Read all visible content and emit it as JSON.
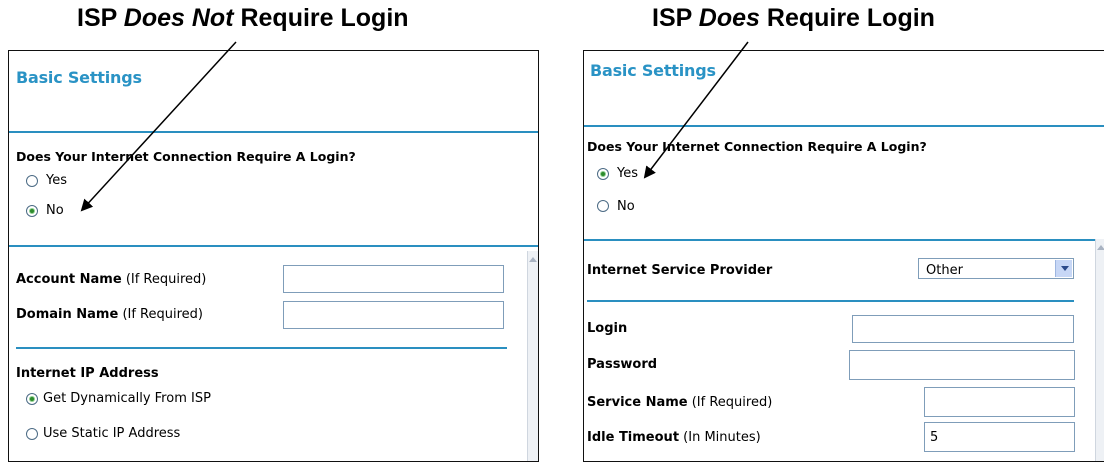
{
  "left": {
    "caption_a": "ISP ",
    "caption_em": "Does Not",
    "caption_b": " Require Login",
    "title": "Basic Settings",
    "question": "Does Your Internet Connection Require A Login?",
    "login_options": [
      {
        "label": "Yes",
        "selected": false
      },
      {
        "label": "No",
        "selected": true
      }
    ],
    "account_name_label": "Account Name",
    "account_name_hint": "(If Required)",
    "account_name_value": "",
    "domain_name_label": "Domain Name",
    "domain_name_hint": "(If Required)",
    "domain_name_value": "",
    "ip_section_label": "Internet IP Address",
    "ip_options": [
      {
        "label": "Get Dynamically From ISP",
        "selected": true
      },
      {
        "label": "Use Static IP Address",
        "selected": false
      }
    ]
  },
  "right": {
    "caption_a": "ISP ",
    "caption_em": "Does",
    "caption_b": " Require Login",
    "title": "Basic Settings",
    "question": "Does Your Internet Connection Require A Login?",
    "login_options": [
      {
        "label": "Yes",
        "selected": true
      },
      {
        "label": "No",
        "selected": false
      }
    ],
    "isp_label": "Internet Service Provider",
    "isp_selected": "Other",
    "login_label": "Login",
    "login_value": "",
    "password_label": "Password",
    "password_value": "",
    "service_name_label": "Service Name",
    "service_name_hint": "(If Required)",
    "service_name_value": "",
    "idle_timeout_label": "Idle Timeout",
    "idle_timeout_hint": "(In Minutes)",
    "idle_timeout_value": "5"
  },
  "colors": {
    "title_blue": "#2a93c5",
    "rule_blue": "#2a8fc0",
    "radio_selected": "#2e8b2e"
  }
}
